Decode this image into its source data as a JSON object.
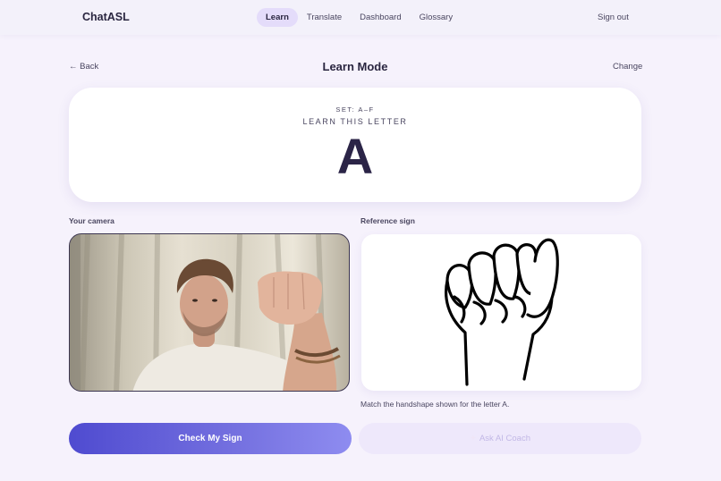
{
  "brand": "ChatASL",
  "nav": {
    "tabs": [
      "Learn",
      "Translate",
      "Dashboard",
      "Glossary"
    ],
    "active": "Learn",
    "sign_out": "Sign out"
  },
  "header": {
    "back": "← Back",
    "title": "Learn Mode",
    "change": "Change"
  },
  "card": {
    "set": "SET: A–F",
    "prompt": "LEARN THIS LETTER",
    "letter": "A"
  },
  "panels": {
    "camera_label": "Your camera",
    "reference_label": "Reference sign",
    "hint": "Match the handshape shown for the letter A."
  },
  "actions": {
    "check": "Check My Sign",
    "coach_icon": "sparkle-icon",
    "coach": "Ask AI Coach"
  },
  "colors": {
    "accent": "#4f4bd0",
    "background": "#f6f2fc",
    "active_tab": "#e4dcfa"
  }
}
